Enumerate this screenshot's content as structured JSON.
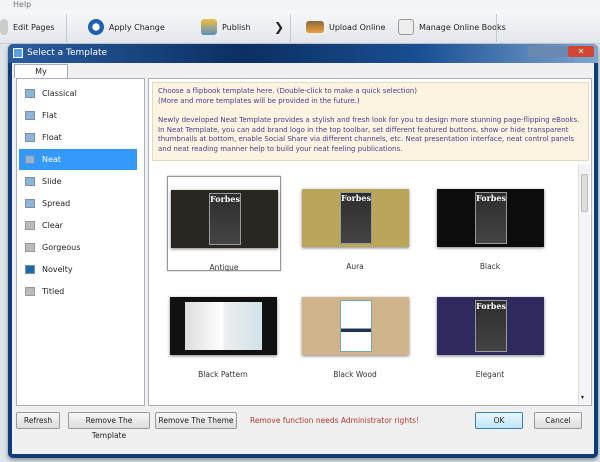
{
  "menu": {
    "help": "Help"
  },
  "toolbar": {
    "items": [
      {
        "label": "Edit Pages",
        "icon": "edit-pages-icon"
      },
      {
        "label": "Apply Change",
        "icon": "refresh-circle-icon"
      },
      {
        "label": "Publish",
        "icon": "publish-icon"
      },
      {
        "label": "Upload Online",
        "icon": "upload-icon"
      },
      {
        "label": "Manage Online Books",
        "icon": "manage-books-icon"
      }
    ]
  },
  "dialog": {
    "title": "Select a Template",
    "tab": "My Templates",
    "templates": [
      {
        "label": "Classical",
        "icon": "blue"
      },
      {
        "label": "Flat",
        "icon": "blue"
      },
      {
        "label": "Float",
        "icon": "blue"
      },
      {
        "label": "Neat",
        "icon": "blue",
        "selected": true
      },
      {
        "label": "Slide",
        "icon": "blue"
      },
      {
        "label": "Spread",
        "icon": "blue"
      },
      {
        "label": "Clear",
        "icon": "gray"
      },
      {
        "label": "Gorgeous",
        "icon": "gray"
      },
      {
        "label": "Novelty",
        "icon": "dark"
      },
      {
        "label": "Titled",
        "icon": "gray"
      }
    ],
    "info": {
      "line1": "Choose a flipbook template here. (Double-click to make a quick selection)",
      "line2": "(More and more templates will be provided in the future.)",
      "description": "Newly developed Neat Template provides a stylish and fresh look for you to design more stunning page-flipping eBooks. In Neat Template, you can add brand logo in the top toolbar, set different featured buttons, show or hide transparent thumbnails at bottom, enable Social Share via different channels, etc. Neat presentation interface, neat control panels and neat reading manner help to build your neat feeling publications."
    },
    "themes": [
      {
        "label": "Antique",
        "bg": "#2a2622",
        "selected": true,
        "cover": "Forbes"
      },
      {
        "label": "Aura",
        "bg": "#b9a65a",
        "cover": "Forbes"
      },
      {
        "label": "Black",
        "bg": "#0c0c0c",
        "cover": "Forbes"
      },
      {
        "label": "Black Pattern",
        "bg": "#111111"
      },
      {
        "label": "Black Wood",
        "bg": "#cfb48c"
      },
      {
        "label": "Elegant",
        "bg": "#2e2a5e",
        "cover": "Forbes"
      }
    ],
    "buttons": {
      "refresh": "Refresh",
      "remove_template": "Remove The Template",
      "remove_theme": "Remove The Theme",
      "ok": "OK",
      "cancel": "Cancel"
    },
    "warning": "Remove function needs Administrator rights!",
    "colors": {
      "selection": "#3399ff",
      "warning": "#b03a2e",
      "info_bg": "#fcf4e0"
    }
  }
}
